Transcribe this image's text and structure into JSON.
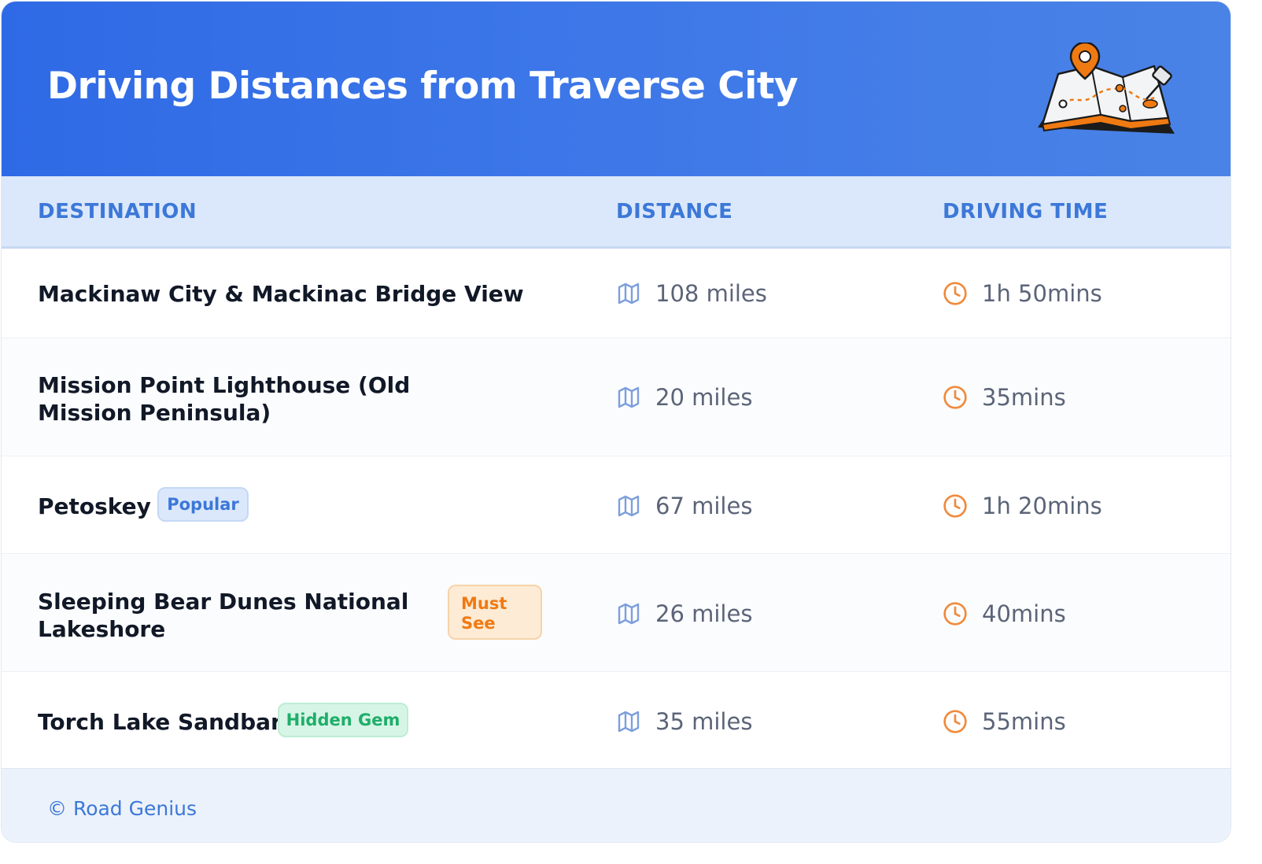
{
  "header": {
    "title": "Driving Distances from Traverse City",
    "icon": "map-with-pin-icon"
  },
  "table": {
    "columns": [
      "DESTINATION",
      "DISTANCE",
      "DRIVING TIME"
    ],
    "rows": [
      {
        "destination": "Mackinaw City & Mackinac Bridge View",
        "badge": "",
        "distance": "108 miles",
        "time": "1h 50mins"
      },
      {
        "destination": "Mission Point Lighthouse (Old Mission Peninsula)",
        "badge": "",
        "distance": "20 miles",
        "time": "35mins"
      },
      {
        "destination": "Petoskey",
        "badge": "Popular",
        "distance": "67 miles",
        "time": "1h 20mins"
      },
      {
        "destination": "Sleeping Bear Dunes National Lakeshore",
        "badge": "Must See",
        "distance": "26 miles",
        "time": "40mins"
      },
      {
        "destination": "Torch Lake Sandbar",
        "badge": "Hidden Gem",
        "distance": "35 miles",
        "time": "55mins"
      }
    ],
    "distance_icon": "map-icon",
    "time_icon": "clock-icon"
  },
  "footer": {
    "text": "© Road Genius"
  },
  "colors": {
    "header_gradient_start": "#2f6ae6",
    "header_gradient_end": "#4a83e6",
    "accent_blue": "#3c78d8",
    "badge_orange": "#f07a12",
    "badge_green": "#1fae6a",
    "clock_orange": "#f08a3c"
  }
}
